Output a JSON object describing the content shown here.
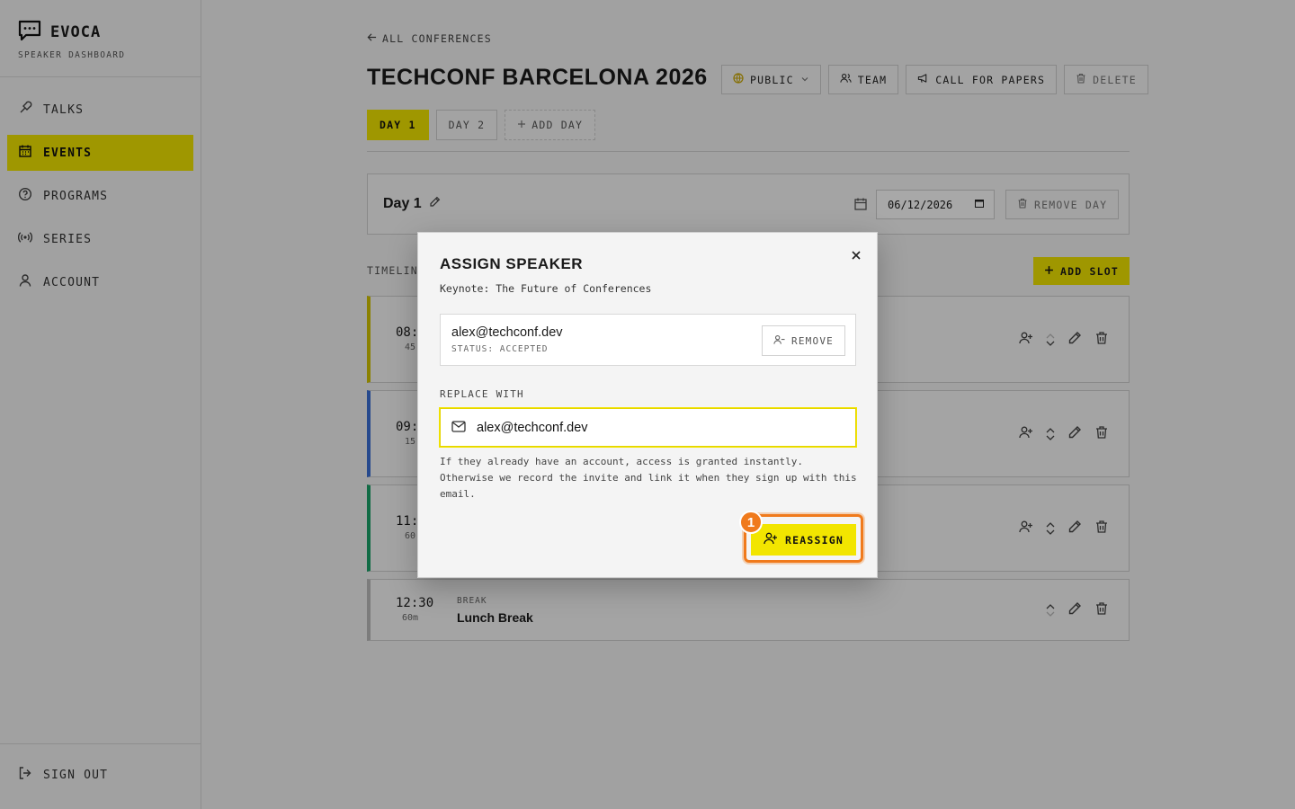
{
  "sidebar": {
    "brand": "EVOCA",
    "brand_sub": "SPEAKER DASHBOARD",
    "items": [
      {
        "label": "TALKS",
        "icon": "mic-icon"
      },
      {
        "label": "EVENTS",
        "icon": "calendar-icon",
        "active": true
      },
      {
        "label": "PROGRAMS",
        "icon": "help-circle-icon"
      },
      {
        "label": "SERIES",
        "icon": "broadcast-icon"
      },
      {
        "label": "ACCOUNT",
        "icon": "user-icon"
      }
    ],
    "signout": "SIGN OUT"
  },
  "header": {
    "back": "ALL CONFERENCES",
    "title": "TECHCONF BARCELONA 2026",
    "buttons": {
      "public": "PUBLIC",
      "team": "TEAM",
      "cfp": "CALL FOR PAPERS",
      "delete": "DELETE"
    }
  },
  "days": {
    "tabs": [
      "DAY 1",
      "DAY 2"
    ],
    "add": "ADD DAY",
    "current": {
      "name": "Day 1",
      "date": "06/12/2026",
      "remove": "REMOVE DAY"
    }
  },
  "timeline": {
    "label": "TIMELIN",
    "add_slot": "ADD SLOT",
    "slots": [
      {
        "time": "08:",
        "duration": "45",
        "color": "#d4c400"
      },
      {
        "time": "09:",
        "duration": "15",
        "color": "#3b6fd6"
      },
      {
        "time": "11:",
        "duration": "60",
        "color": "#1aa36a"
      },
      {
        "time": "12:30",
        "duration": "60m",
        "kind": "BREAK",
        "title": "Lunch Break",
        "color": "#bdbdbd"
      }
    ]
  },
  "modal": {
    "title": "ASSIGN SPEAKER",
    "subtitle": "Keynote: The Future of Conferences",
    "current": {
      "email": "alex@techconf.dev",
      "status": "STATUS: ACCEPTED",
      "remove": "REMOVE"
    },
    "replace_label": "REPLACE WITH",
    "replace_value": "alex@techconf.dev",
    "help": "If they already have an account, access is granted instantly. Otherwise we record the invite and link it when they sign up with this email.",
    "reassign": "REASSIGN",
    "step_badge": "1"
  },
  "colors": {
    "accent": "#f2e500",
    "highlight": "#f07a1c"
  }
}
